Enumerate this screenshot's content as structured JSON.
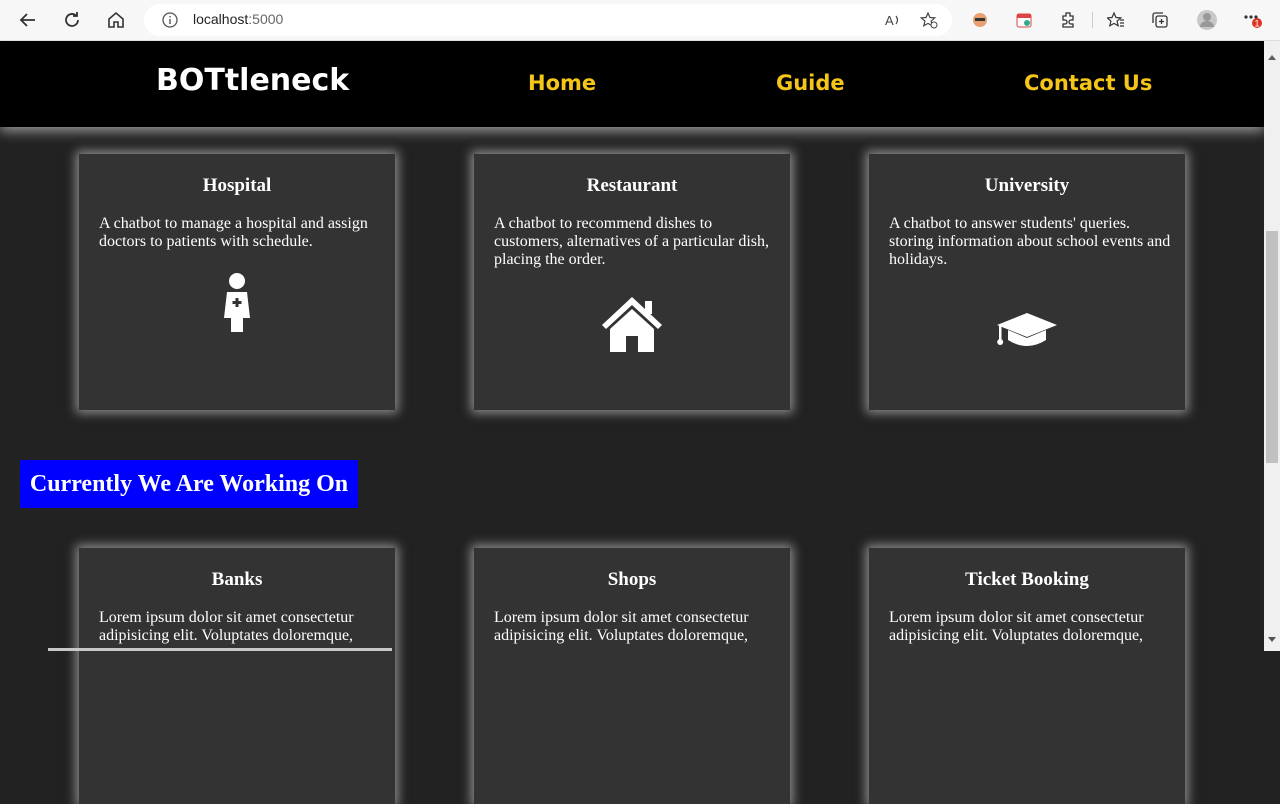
{
  "browser": {
    "url_host": "localhost",
    "url_port": ":5000",
    "notification_count": "1"
  },
  "nav": {
    "brand": "BOTtleneck",
    "links": [
      "Home",
      "Guide",
      "Contact Us"
    ],
    "link_color": "#f5c518"
  },
  "current_cards": [
    {
      "title": "Hospital",
      "description": "A chatbot to manage a hospital and assign doctors to patients with schedule.",
      "icon": "nurse-icon"
    },
    {
      "title": "Restaurant",
      "description": "A chatbot to recommend dishes to customers, alternatives of a particular dish, placing the order.",
      "icon": "home-icon"
    },
    {
      "title": "University",
      "description": "A chatbot to answer students' queries. storing information about school events and holidays.",
      "icon": "graduation-cap-icon"
    }
  ],
  "section": {
    "heading": "Currently We Are Working On",
    "bg_color": "#0000ff"
  },
  "upcoming_cards": [
    {
      "title": "Banks",
      "description": "Lorem ipsum dolor sit amet consectetur adipisicing elit. Voluptates doloremque,"
    },
    {
      "title": "Shops",
      "description": "Lorem ipsum dolor sit amet consectetur adipisicing elit. Voluptates doloremque,"
    },
    {
      "title": "Ticket Booking",
      "description": "Lorem ipsum dolor sit amet consectetur adipisicing elit. Voluptates doloremque,"
    }
  ]
}
